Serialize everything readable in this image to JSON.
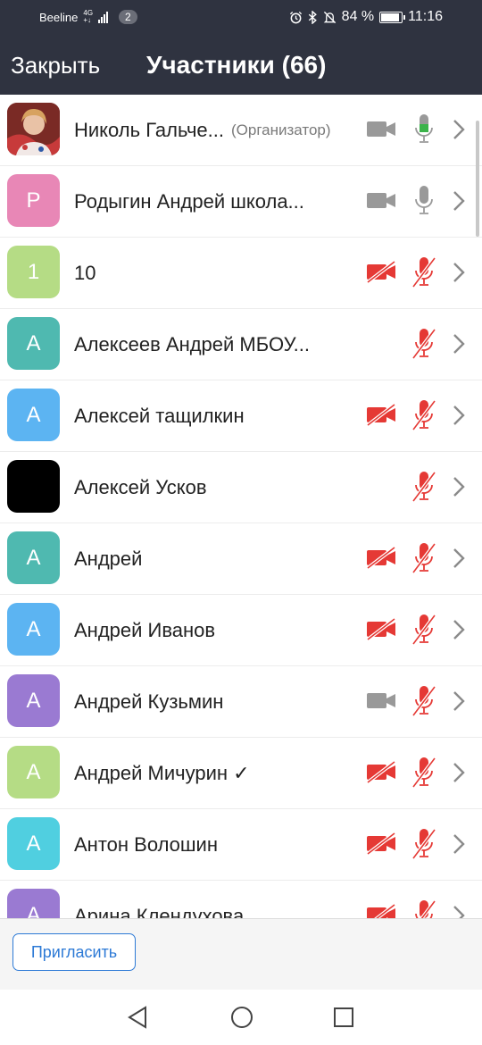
{
  "status_bar": {
    "carrier": "Beeline",
    "network": "4G",
    "network_sub": "+↓",
    "notification_count": "2",
    "battery": "84 %",
    "time": "11:16",
    "icons": [
      "alarm-icon",
      "bluetooth-icon",
      "mute-icon",
      "battery-icon"
    ]
  },
  "header": {
    "close_label": "Закрыть",
    "title": "Участники (66)"
  },
  "participants": [
    {
      "name": "Николь Гальче...",
      "role": "(Организатор)",
      "avatar": "",
      "avatar_type": "photo",
      "avatar_color": "#a04040",
      "camera": "on",
      "mic": "active"
    },
    {
      "name": "Родыгин Андрей школа...",
      "role": "",
      "avatar": "Р",
      "avatar_type": "letter",
      "avatar_color": "#e887b6",
      "camera": "on",
      "mic": "on"
    },
    {
      "name": "10",
      "role": "",
      "avatar": "1",
      "avatar_type": "letter",
      "avatar_color": "#b5dc85",
      "camera": "off",
      "mic": "off"
    },
    {
      "name": "Алексеев Андрей МБОУ...",
      "role": "",
      "avatar": "А",
      "avatar_type": "letter",
      "avatar_color": "#4fb9b0",
      "camera": "none",
      "mic": "off"
    },
    {
      "name": "Алексей тащилкин",
      "role": "",
      "avatar": "А",
      "avatar_type": "letter",
      "avatar_color": "#5cb4f2",
      "camera": "off",
      "mic": "off"
    },
    {
      "name": "Алексей Усков",
      "role": "",
      "avatar": "",
      "avatar_type": "black",
      "avatar_color": "#000000",
      "camera": "none",
      "mic": "off"
    },
    {
      "name": "Андрей",
      "role": "",
      "avatar": "А",
      "avatar_type": "letter",
      "avatar_color": "#4fb9b0",
      "camera": "off",
      "mic": "off"
    },
    {
      "name": "Андрей Иванов",
      "role": "",
      "avatar": "А",
      "avatar_type": "letter",
      "avatar_color": "#5cb4f2",
      "camera": "off",
      "mic": "off"
    },
    {
      "name": "Андрей Кузьмин",
      "role": "",
      "avatar": "А",
      "avatar_type": "letter",
      "avatar_color": "#9a7ad2",
      "camera": "on",
      "mic": "off"
    },
    {
      "name": "Андрей Мичурин ✓",
      "role": "",
      "avatar": "А",
      "avatar_type": "letter",
      "avatar_color": "#b5dc85",
      "camera": "off",
      "mic": "off"
    },
    {
      "name": "Антон Волошин",
      "role": "",
      "avatar": "А",
      "avatar_type": "letter",
      "avatar_color": "#50cfe0",
      "camera": "off",
      "mic": "off"
    },
    {
      "name": "Арина Клендухова",
      "role": "",
      "avatar": "А",
      "avatar_type": "letter",
      "avatar_color": "#9a7ad2",
      "camera": "off",
      "mic": "off"
    }
  ],
  "footer": {
    "invite_label": "Пригласить"
  },
  "colors": {
    "header_bg": "#2f3340",
    "muted_red": "#e53935",
    "icon_gray": "#999999",
    "mic_active_green": "#3bb34a",
    "accent_blue": "#2d7ad6"
  }
}
